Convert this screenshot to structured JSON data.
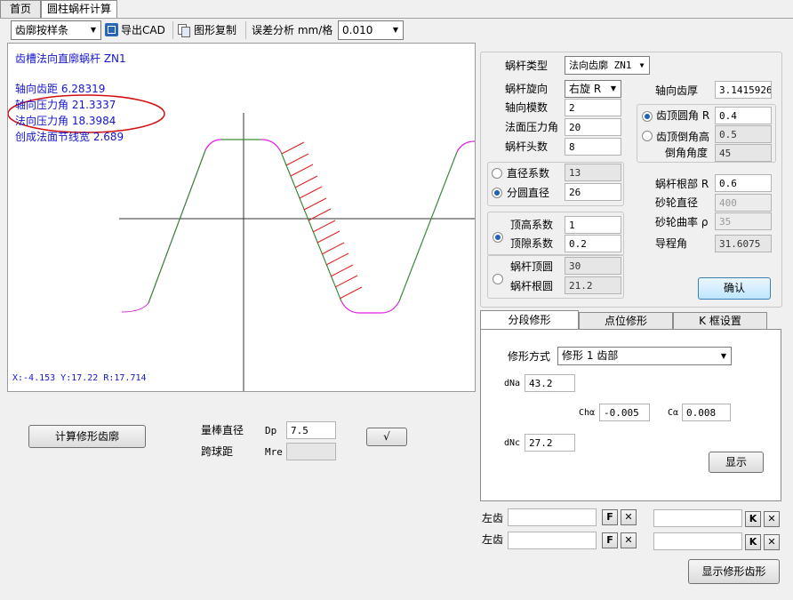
{
  "tabs": [
    {
      "label": "首页",
      "active": false
    },
    {
      "label": "圆柱蜗杆计算",
      "active": true
    }
  ],
  "toolbar": {
    "mode_select": "齿廓按样条",
    "export_cad": "导出CAD",
    "copy_graphic": "图形复制",
    "error_label": "误差分析 mm/格",
    "error_value": "0.010"
  },
  "plot": {
    "title": "齿槽法向直廓蜗杆  ZN1",
    "lines": [
      "轴向齿距   6.28319",
      "轴向压力角 21.3337",
      "法向压力角 18.3984",
      "创成法面节线宽  2.689"
    ],
    "coords": "X:-4.153  Y:17.22  R:17.714",
    "colors": {
      "profile": "#3a8a3a",
      "fillet": "#e020e0",
      "hatch": "#e02020",
      "annotation": "#d01010",
      "axis": "#333333"
    }
  },
  "params": {
    "worm_type_label": "蜗杆类型",
    "worm_type_value": "法向齿廓 ZN1",
    "rotation_label": "蜗杆旋向",
    "rotation_value": "右旋 R",
    "axial_module_label": "轴向模数",
    "axial_module_value": "2",
    "normal_pressure_label": "法面压力角",
    "normal_pressure_value": "20",
    "starts_label": "蜗杆头数",
    "starts_value": "8",
    "axial_thickness_label": "轴向齿厚",
    "axial_thickness_value": "3.1415926",
    "tip_fillet_label": "齿顶圆角 R",
    "tip_fillet_value": "0.4",
    "tip_chamfer_label": "齿顶倒角高",
    "tip_chamfer_value": "0.5",
    "chamfer_angle_label": "倒角角度",
    "chamfer_angle_value": "45",
    "diam_coef_label": "直径系数",
    "diam_coef_value": "13",
    "pitch_diam_label": "分圆直径",
    "pitch_diam_value": "26",
    "root_r_label": "蜗杆根部 R",
    "root_r_value": "0.6",
    "wheel_diam_label": "砂轮直径",
    "wheel_diam_value": "400",
    "wheel_curv_label": "砂轮曲率 ρ",
    "wheel_curv_value": "35",
    "addendum_label": "顶高系数",
    "addendum_value": "1",
    "clearance_label": "顶隙系数",
    "clearance_value": "0.2",
    "lead_angle_label": "导程角",
    "lead_angle_value": "31.6075",
    "tip_diam_label": "蜗杆顶圆",
    "tip_diam_value": "30",
    "root_diam_label": "蜗杆根圆",
    "root_diam_value": "21.2",
    "confirm_button": "确认"
  },
  "subtabs": [
    {
      "label": "分段修形",
      "active": true
    },
    {
      "label": "点位修形",
      "active": false
    },
    {
      "label": "K 框设置",
      "active": false
    }
  ],
  "modify": {
    "method_label": "修形方式",
    "method_value": "修形 1  齿部",
    "dna_label": "dNa",
    "dna_value": "43.2",
    "ch_label": "Chα",
    "ch_value": "-0.005",
    "ca_label": "Cα",
    "ca_value": "0.008",
    "dnc_label": "dNc",
    "dnc_value": "27.2",
    "show_button": "显示"
  },
  "flanks": {
    "left_label_1": "左齿",
    "left_label_2": "左齿",
    "f_button": "F",
    "k_button": "K",
    "x_button": "✕"
  },
  "bottom": {
    "calc_button": "计算修形齿廓",
    "rod_diam_label": "量棒直径",
    "dp_label": "Dp",
    "dp_value": "7.5",
    "ball_dist_label": "跨球距",
    "mre_label": "Mre",
    "check_symbol": "√",
    "show_profile_button": "显示修形齿形"
  }
}
